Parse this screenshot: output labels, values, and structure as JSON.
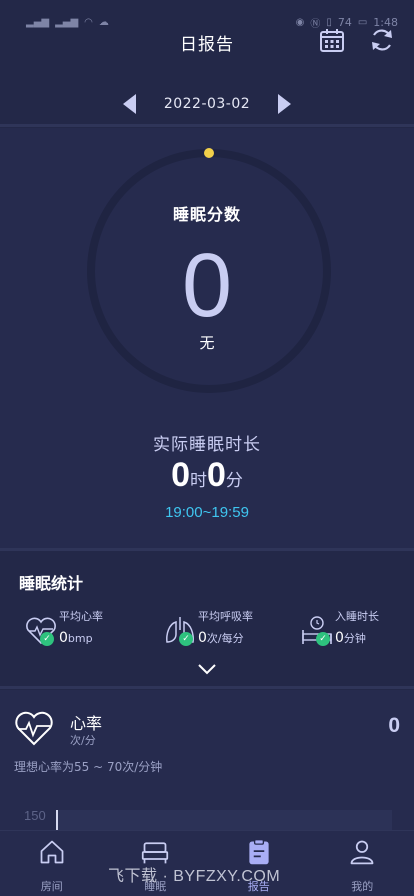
{
  "status_bar": {
    "time": "1:48",
    "battery": "74"
  },
  "header": {
    "title": "日报告"
  },
  "date_nav": {
    "date": "2022-03-02"
  },
  "score": {
    "label": "睡眠分数",
    "value": "0",
    "grade": "无"
  },
  "duration": {
    "label": "实际睡眠时长",
    "hours": "0",
    "hours_unit": "时",
    "minutes": "0",
    "minutes_unit": "分",
    "time_range": "19:00~19:59"
  },
  "stats": {
    "title": "睡眠统计",
    "items": [
      {
        "label": "平均心率",
        "value": "0",
        "unit": "bmp",
        "icon": "heart-rate-icon"
      },
      {
        "label": "平均呼吸率",
        "value": "0",
        "unit": "次/每分",
        "icon": "lungs-icon"
      },
      {
        "label": "入睡时长",
        "value": "0",
        "unit": "分钟",
        "icon": "bed-clock-icon"
      }
    ]
  },
  "heart_rate": {
    "title": "心率",
    "unit": "次/分",
    "value": "0",
    "ideal_text": "理想心率为55 ~ 70次/分钟",
    "axis_max": "150"
  },
  "tabs": [
    {
      "label": "房间",
      "icon": "home-icon",
      "active": false
    },
    {
      "label": "睡眠",
      "icon": "bed-icon",
      "active": false
    },
    {
      "label": "报告",
      "icon": "report-icon",
      "active": true
    },
    {
      "label": "我的",
      "icon": "user-icon",
      "active": false
    }
  ],
  "watermark": "飞下载 · BYFZXY.COM",
  "colors": {
    "background": "#232848",
    "accent_cyan": "#3fc6f0",
    "check_green": "#2ec27e",
    "ring_dot": "#f2d04a",
    "active_tab": "#a9aef5"
  }
}
